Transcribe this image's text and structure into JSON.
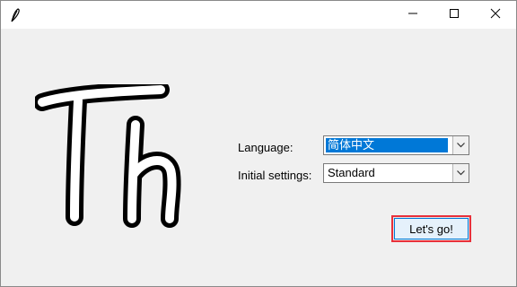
{
  "window": {
    "title": "",
    "icon": "feather-icon"
  },
  "titlebar": {
    "minimize_icon": "minimize-icon",
    "maximize_icon": "maximize-icon",
    "close_icon": "close-icon"
  },
  "logo": {
    "text": "Th"
  },
  "form": {
    "language_label": "Language:",
    "language_value": "简体中文",
    "initial_settings_label": "Initial settings:",
    "initial_settings_value": "Standard"
  },
  "actions": {
    "go_label": "Let's go!"
  },
  "colors": {
    "selection": "#0078d7",
    "highlight_border": "#e8303a",
    "window_bg": "#f0f0f0"
  }
}
